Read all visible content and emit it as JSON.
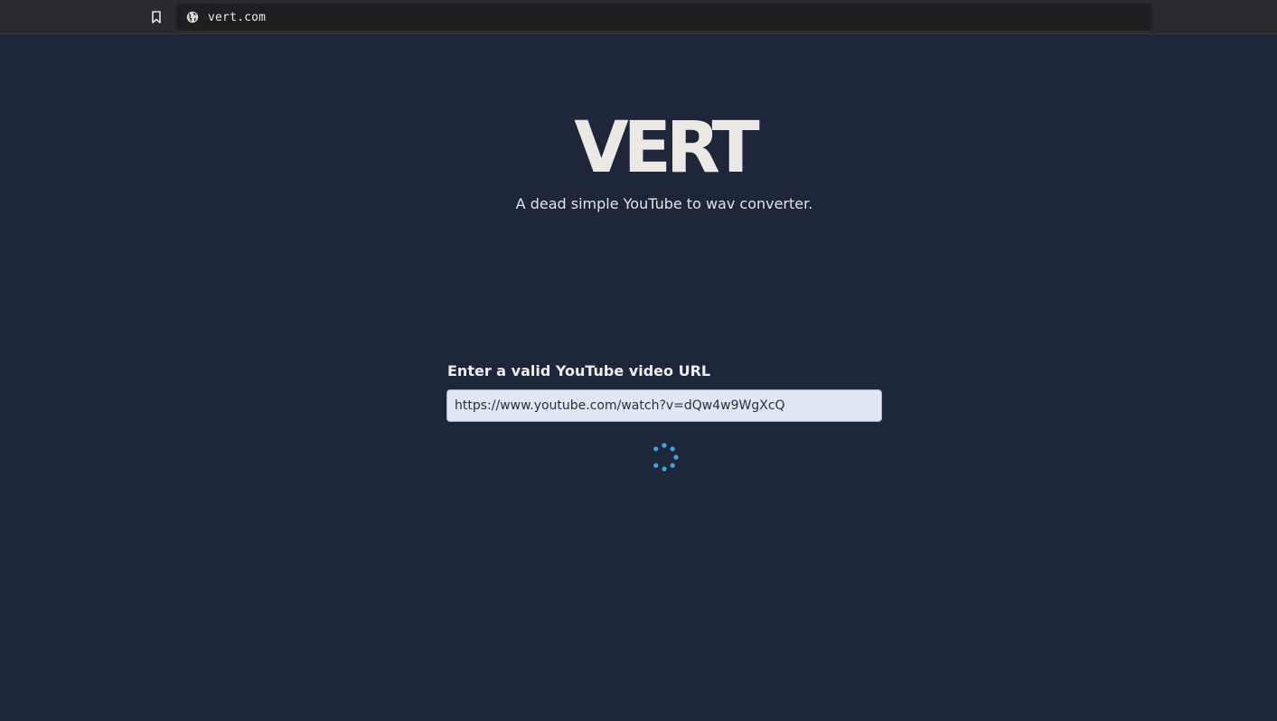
{
  "browser": {
    "url": "vert.com",
    "icons": {
      "bookmark": "bookmark-icon",
      "site_info": "globe-icon"
    }
  },
  "app": {
    "logo": "VERT",
    "tagline": "A dead simple YouTube to wav converter."
  },
  "form": {
    "label": "Enter a valid YouTube video URL",
    "input_value": "https://www.youtube.com/watch?v=dQw4w9WgXcQ"
  },
  "status": {
    "loading_icon": "spinner-icon",
    "spinner_color": "#3aa8e0"
  },
  "colors": {
    "background": "#1e273a",
    "logo": "#ece8e4",
    "input_bg": "#e1e7f0"
  }
}
